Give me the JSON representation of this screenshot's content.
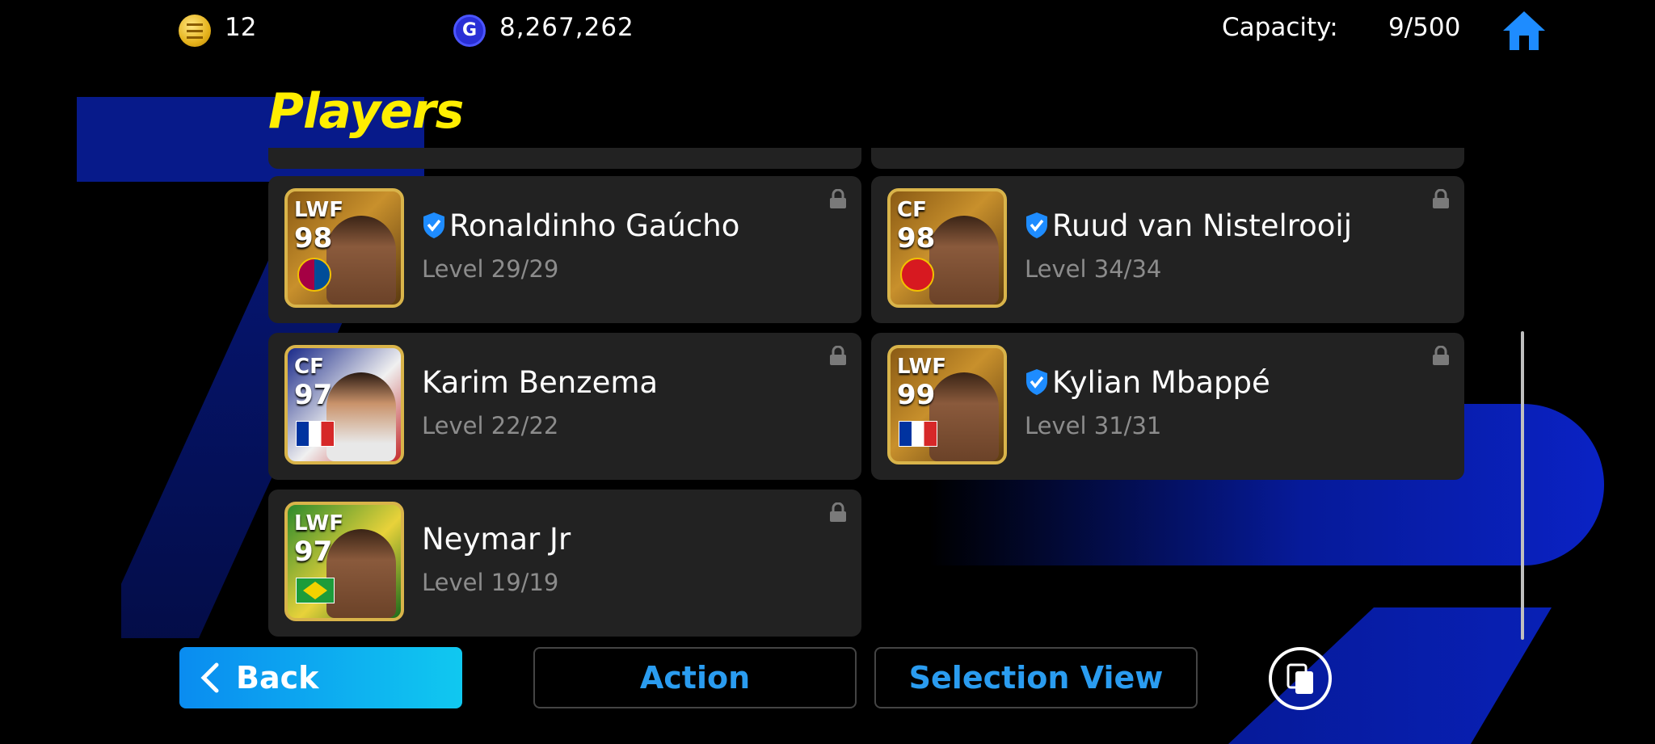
{
  "header": {
    "coins": "12",
    "gp": "8,267,262",
    "capacity_label": "Capacity:",
    "capacity_value": "9/500"
  },
  "title": "Players",
  "players": [
    {
      "position": "LWF",
      "rating": "98",
      "name": "Ronaldinho Gaúcho",
      "level": "Level 29/29",
      "verified": true,
      "locked": true
    },
    {
      "position": "CF",
      "rating": "98",
      "name": "Ruud van Nistelrooij",
      "level": "Level 34/34",
      "verified": true,
      "locked": true
    },
    {
      "position": "CF",
      "rating": "97",
      "name": "Karim Benzema",
      "level": "Level 22/22",
      "verified": false,
      "locked": true
    },
    {
      "position": "LWF",
      "rating": "99",
      "name": "Kylian Mbappé",
      "level": "Level 31/31",
      "verified": true,
      "locked": true
    },
    {
      "position": "LWF",
      "rating": "97",
      "name": "Neymar Jr",
      "level": "Level 19/19",
      "verified": false,
      "locked": true
    }
  ],
  "footer": {
    "back_label": "Back",
    "action_label": "Action",
    "selection_view_label": "Selection View"
  },
  "colors": {
    "title": "#ffee00",
    "accent": "#2a9cf0",
    "card": "#222222"
  },
  "icons": [
    "coin-icon",
    "gp-icon",
    "home-icon",
    "verified-icon",
    "lock-icon",
    "chevron-left-icon",
    "copy-icon"
  ]
}
